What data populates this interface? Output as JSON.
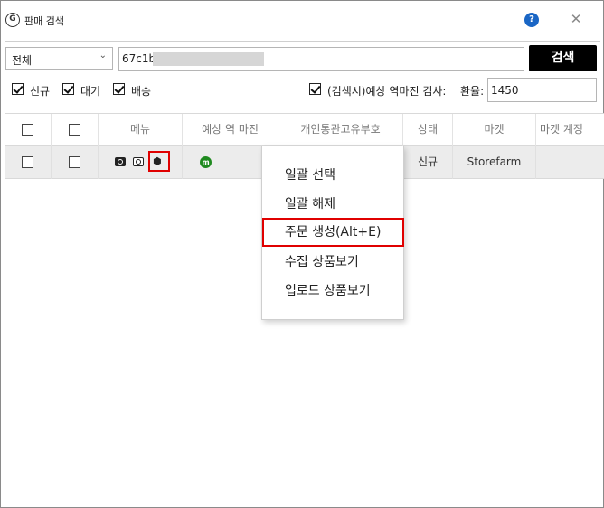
{
  "window": {
    "title": "판매 검색",
    "app_icon_glyph": "G",
    "help_glyph": "?",
    "close_glyph": "✕"
  },
  "search": {
    "category_value": "전체",
    "query_value": "67c1b",
    "button_label": "검색"
  },
  "options": {
    "filters": [
      {
        "label": "신규",
        "checked": true
      },
      {
        "label": "대기",
        "checked": true
      },
      {
        "label": "배송",
        "checked": true
      }
    ],
    "reverse_margin_label": "(검색시)예상 역마진 검사:",
    "reverse_margin_checked": true,
    "rate_label": "환율:",
    "rate_value": "1450"
  },
  "grid": {
    "columns": [
      "",
      "",
      "메뉴",
      "예상 역 마진",
      "개인통관고유부호",
      "상태",
      "마켓",
      "마켓 계정"
    ],
    "rows": [
      {
        "status": "신규",
        "market": "Storefarm",
        "margin_badge": "m"
      }
    ]
  },
  "context_menu": {
    "items": [
      {
        "label": "일괄 선택",
        "highlighted": false
      },
      {
        "label": "일괄 해제",
        "highlighted": false
      },
      {
        "label": "주문 생성(Alt+E)",
        "highlighted": true
      },
      {
        "label": "수집 상품보기",
        "highlighted": false
      },
      {
        "label": "업로드 상품보기",
        "highlighted": false
      }
    ]
  },
  "colors": {
    "highlight_border": "#e00000",
    "help_blue": "#1a66c5",
    "margin_badge_green": "#1f8a1f",
    "selected_row_bg": "#ececec"
  },
  "icons": [
    "app-logo-icon",
    "help-icon",
    "close-icon",
    "chevron-down-icon",
    "search-icon",
    "search-outline-icon",
    "box-icon"
  ]
}
